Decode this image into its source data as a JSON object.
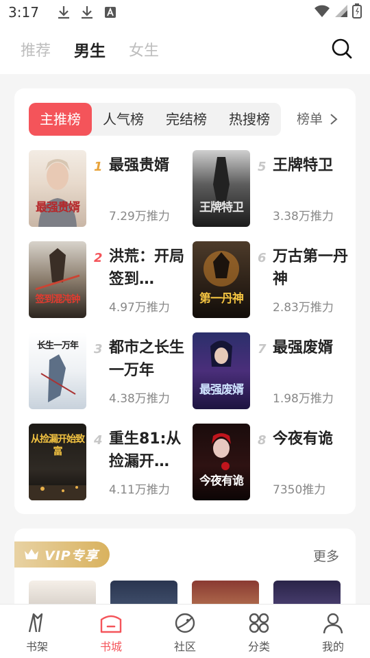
{
  "status_bar": {
    "time": "3:17"
  },
  "top_tabs": [
    {
      "label": "推荐",
      "active": false
    },
    {
      "label": "男生",
      "active": true
    },
    {
      "label": "女生",
      "active": false
    }
  ],
  "ranking": {
    "tabs": [
      "主推榜",
      "人气榜",
      "完结榜",
      "热搜榜"
    ],
    "active_tab": "主推榜",
    "list_label": "榜单",
    "books": [
      {
        "rank": "1",
        "title": "最强贵婿",
        "heat": "7.29万推力",
        "cover_text": "最强贵婿"
      },
      {
        "rank": "2",
        "title": "洪荒：开局签到…",
        "heat": "4.97万推力",
        "cover_text": "签到混沌钟"
      },
      {
        "rank": "3",
        "title": "都市之长生一万年",
        "heat": "4.38万推力",
        "cover_text": "长生一万年"
      },
      {
        "rank": "4",
        "title": "重生81:从捡漏开…",
        "heat": "4.11万推力",
        "cover_text": "从捡漏开始致富"
      },
      {
        "rank": "5",
        "title": "王牌特卫",
        "heat": "3.38万推力",
        "cover_text": "王牌特卫"
      },
      {
        "rank": "6",
        "title": "万古第一丹神",
        "heat": "2.83万推力",
        "cover_text": "第一丹神"
      },
      {
        "rank": "7",
        "title": "最强废婿",
        "heat": "1.98万推力",
        "cover_text": "最强废婿"
      },
      {
        "rank": "8",
        "title": "今夜有诡",
        "heat": "7350推力",
        "cover_text": "今夜有诡"
      }
    ]
  },
  "vip": {
    "badge": "VIP专享",
    "more": "更多"
  },
  "bottom_nav": [
    {
      "label": "书架",
      "icon": "bookshelf-icon",
      "active": false
    },
    {
      "label": "书城",
      "icon": "bookstore-icon",
      "active": true
    },
    {
      "label": "社区",
      "icon": "community-icon",
      "active": false
    },
    {
      "label": "分类",
      "icon": "category-icon",
      "active": false
    },
    {
      "label": "我的",
      "icon": "profile-icon",
      "active": false
    }
  ],
  "colors": {
    "accent": "#f4545a",
    "vip_gold": "#d9b25e"
  }
}
